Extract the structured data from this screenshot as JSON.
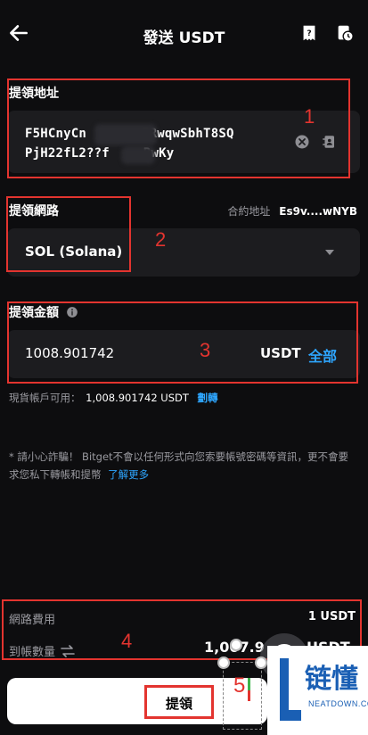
{
  "header": {
    "title": "發送 USDT",
    "back_icon": "arrow-left-icon",
    "help_icon": "help-icon",
    "history_icon": "history-icon"
  },
  "address": {
    "label": "提領地址",
    "line1_prefix": "F5HCnyCn",
    "line1_suffix": "FRwqwSbhT8SQ",
    "line2_prefix": "PjH22fL2??f",
    "line2_suffix": "RwKy"
  },
  "network": {
    "label": "提領網路",
    "contract_label": "合約地址",
    "contract_value": "Es9v....wNYB",
    "selected": "SOL (Solana)"
  },
  "amount": {
    "label": "提領金額",
    "value": "1008.901742",
    "unit": "USDT",
    "all": "全部"
  },
  "balance": {
    "label": "現貨帳戶可用：",
    "value": "1,008.901742 USDT",
    "transfer": "劃轉"
  },
  "notice": {
    "text": "* 請小心詐騙！ Bitget不會以任何形式向您索要帳號密碼等資訊，更不會要求您私下轉帳和提幣",
    "more": "了解更多"
  },
  "fees": {
    "fee_label": "網路費用",
    "fee_value": "1 USDT",
    "receive_label": "到帳數量",
    "receive_value": "1,007.9",
    "receive_unit": "USDT"
  },
  "submit": {
    "label": "提領"
  },
  "annotations": [
    "1",
    "2",
    "3",
    "4",
    "5"
  ],
  "watermark": {
    "cn": "链懂",
    "en": "NEATDOWN.COM"
  },
  "colors": {
    "accent": "#2ea6ff",
    "annotation": "#e3342f",
    "background": "#0d0d0f",
    "field": "#1c1c1f"
  }
}
